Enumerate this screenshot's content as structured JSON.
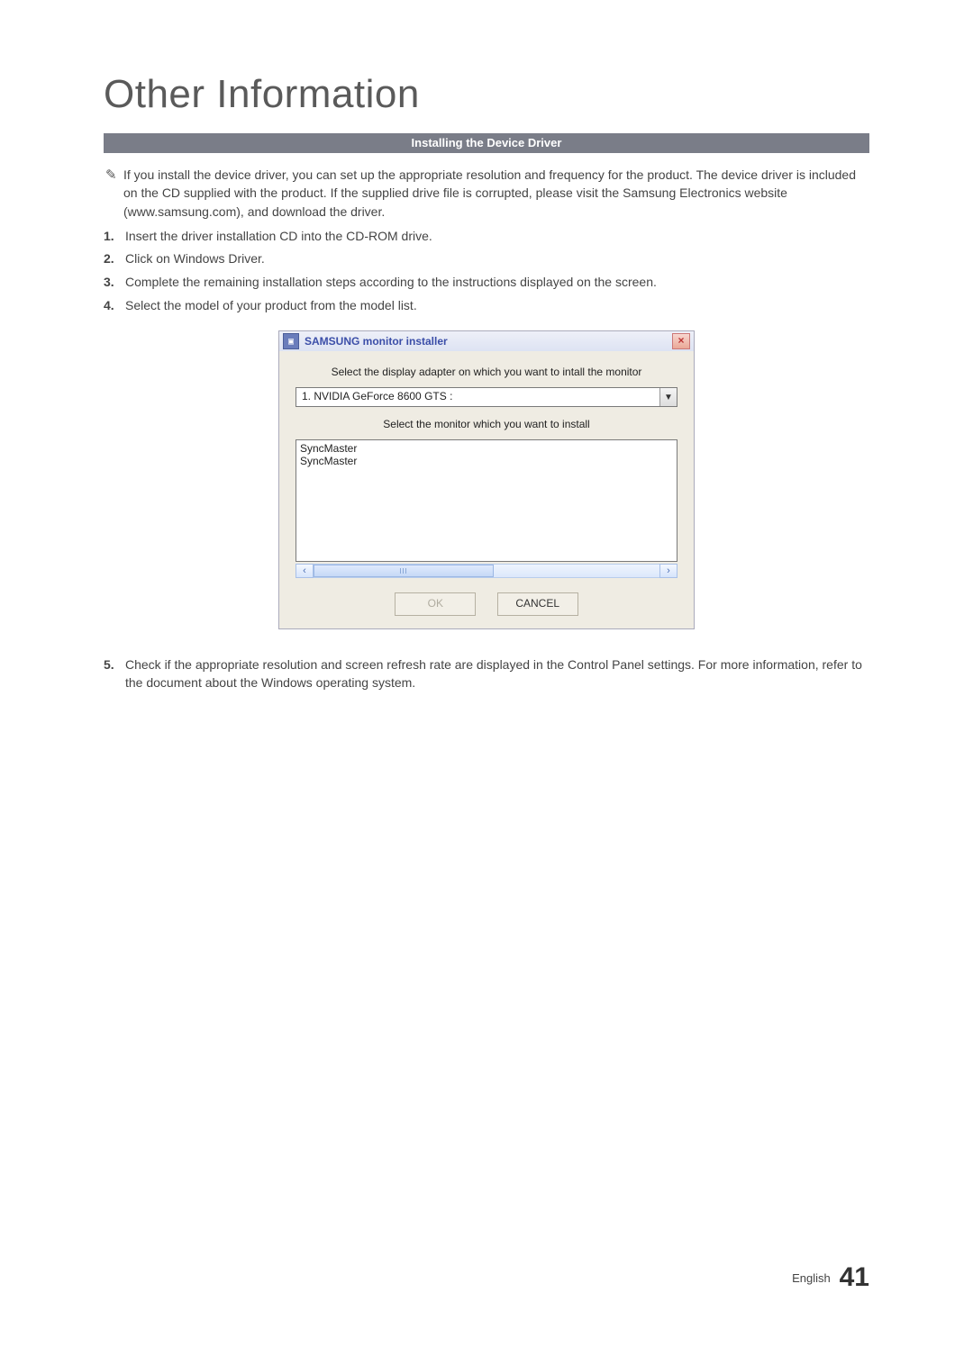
{
  "page": {
    "title": "Other Information",
    "section_heading": "Installing the Device Driver",
    "note_text": "If you install the device driver, you can set up the appropriate resolution and frequency for the product. The device driver is included on the CD supplied with the product. If the supplied drive file is corrupted, please visit the Samsung Electronics website (www.samsung.com), and download the driver.",
    "steps": [
      {
        "num": "1.",
        "text": "Insert the driver installation CD into the CD-ROM drive."
      },
      {
        "num": "2.",
        "text": "Click on Windows Driver."
      },
      {
        "num": "3.",
        "text": "Complete the remaining installation steps according to the instructions displayed on the screen."
      },
      {
        "num": "4.",
        "text": "Select the model of your product from the model list."
      }
    ],
    "step5": {
      "num": "5.",
      "text": "Check if the appropriate resolution and screen refresh rate are displayed in the Control Panel settings. For more information, refer to the document about the Windows operating system."
    },
    "footer_lang": "English",
    "footer_page": "41"
  },
  "dialog": {
    "title": "SAMSUNG monitor installer",
    "label_adapter": "Select the display adapter on which you want to intall the monitor",
    "combo_value": "1. NVIDIA GeForce 8600 GTS :",
    "label_monitor": "Select the monitor which you want to install",
    "list_items": [
      "SyncMaster",
      "SyncMaster"
    ],
    "btn_ok": "OK",
    "btn_cancel": "CANCEL"
  }
}
